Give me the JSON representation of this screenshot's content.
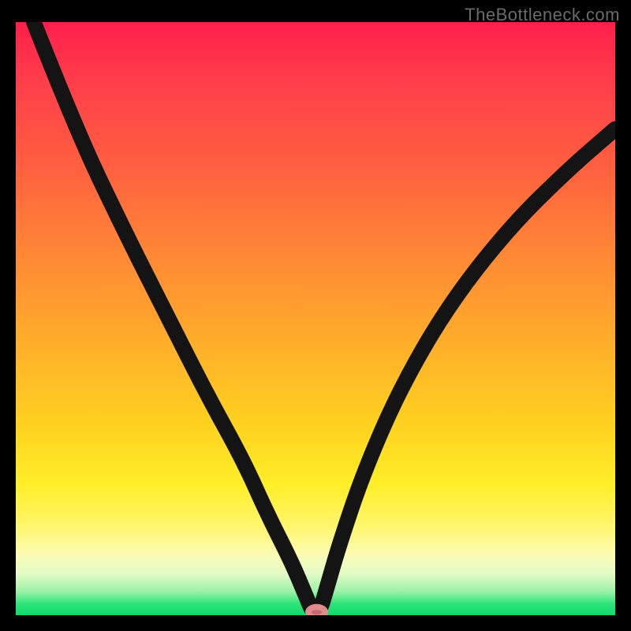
{
  "watermark": "TheBottleneck.com",
  "colors": {
    "black_frame": "#000000",
    "curve": "#141414",
    "marker_fill": "#c46a6c",
    "marker_stroke": "#e28b8c",
    "gradient_top": "#ff1f4a",
    "gradient_bottom": "#0fd96b"
  },
  "chart_data": {
    "type": "line",
    "title": "",
    "xlabel": "",
    "ylabel": "",
    "x_range": [
      0,
      100
    ],
    "y_range": [
      0,
      100
    ],
    "legend": false,
    "grid": false,
    "series": [
      {
        "name": "curve",
        "x": [
          3,
          10,
          18,
          26,
          32,
          38,
          42,
          46,
          48.5,
          49.5,
          50.7,
          52,
          54,
          58,
          64,
          72,
          82,
          92,
          100
        ],
        "y": [
          100,
          82,
          65,
          49,
          37,
          26,
          17,
          9,
          3,
          0.5,
          0.5,
          5,
          12,
          24,
          38,
          52,
          65,
          75,
          82
        ]
      }
    ],
    "marker": {
      "x": 50.2,
      "y": 0.5,
      "shape": "ellipse",
      "rx": 1.4,
      "ry": 0.9
    },
    "note": "Values are percentages of the plot area; no numeric axes are displayed in the image."
  }
}
